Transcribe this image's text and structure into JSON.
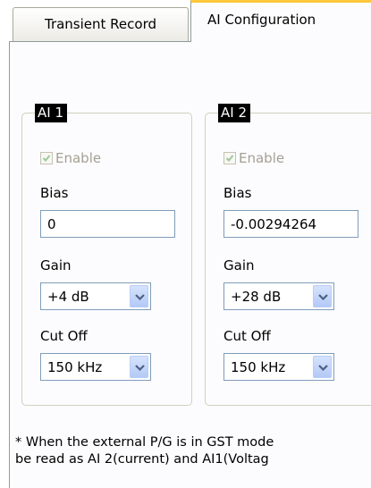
{
  "tabs": [
    {
      "label": "Transient Record",
      "active": false
    },
    {
      "label": "AI Configuration",
      "active": true
    }
  ],
  "groups": [
    {
      "title": "AI 1",
      "enable_label": "Enable",
      "enable_checked": true,
      "enable_disabled": true,
      "bias_label": "Bias",
      "bias_value": "0",
      "gain_label": "Gain",
      "gain_value": "+4 dB",
      "cutoff_label": "Cut Off",
      "cutoff_value": "150 kHz"
    },
    {
      "title": "AI 2",
      "enable_label": "Enable",
      "enable_checked": true,
      "enable_disabled": true,
      "bias_label": "Bias",
      "bias_value": "-0.00294264",
      "gain_label": "Gain",
      "gain_value": "+28 dB",
      "cutoff_label": "Cut Off",
      "cutoff_value": "150 kHz"
    }
  ],
  "footnote": {
    "line1": "* When the external P/G is in GST mode",
    "line2": "be read as AI 2(current) and AI1(Voltag"
  },
  "icons": {
    "checkmark": "checkmark-icon",
    "dropdown_arrow": "chevron-down-icon"
  },
  "colors": {
    "active_tab_accent": "#ffc83c",
    "group_title_bg": "#000000",
    "disabled_text": "#a4a094",
    "check_color": "#9fc89a",
    "field_border": "#7f9db9",
    "combo_button": "#c3d4fa",
    "combo_arrow": "#4d6185"
  }
}
